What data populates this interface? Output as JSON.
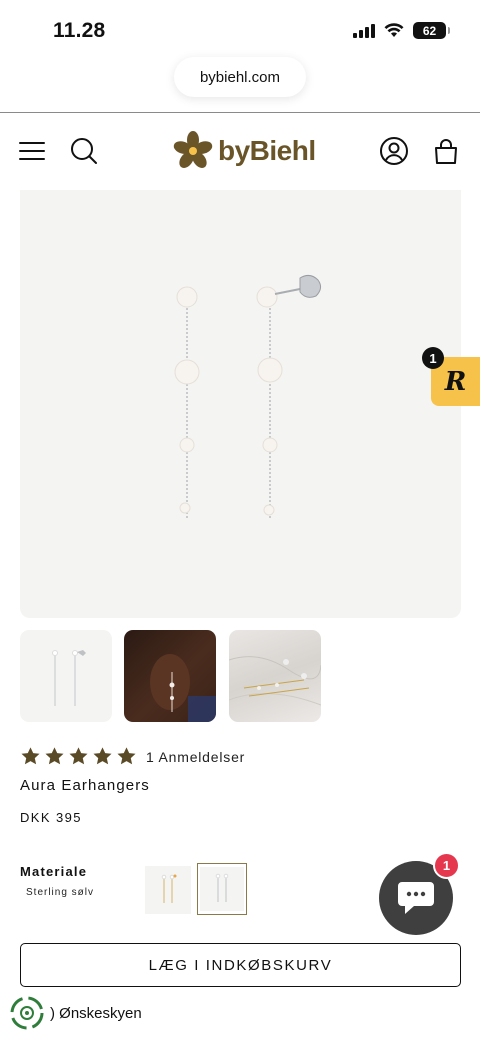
{
  "status_bar": {
    "time": "11.28",
    "battery": "62"
  },
  "browser": {
    "url": "bybiehl.com"
  },
  "header": {
    "logo_text": "byBiehl",
    "icons": [
      "menu-icon",
      "search-icon",
      "account-icon",
      "cart-icon"
    ]
  },
  "reviews_widget": {
    "count": "1",
    "letter": "R"
  },
  "product": {
    "rating_stars": 5,
    "reviews_text": "1 Anmeldelser",
    "title": "Aura Earhangers",
    "price": "DKK 395",
    "material_label": "Materiale",
    "material_value": "Sterling sølv",
    "add_to_cart_label": "LÆG I INDKØBSKURV",
    "thumbnails": [
      "product-photo",
      "model-photo",
      "marble-photo"
    ]
  },
  "chat": {
    "unread": "1"
  },
  "wishlist": {
    "label": "Ønskeskyen"
  },
  "colors": {
    "brand": "#6a5529",
    "star": "#5b4a26",
    "badge_yellow": "#f6c24a",
    "chat_bg": "#3f3f3f",
    "notification": "#e5384f"
  }
}
